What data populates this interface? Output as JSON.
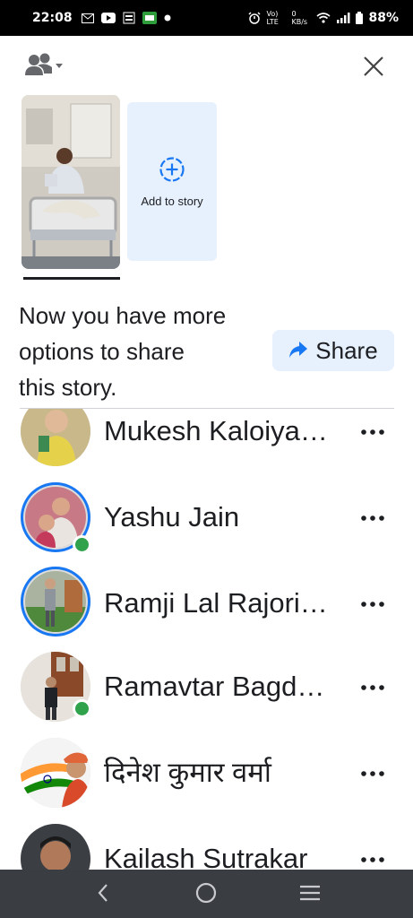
{
  "status_bar": {
    "time": "22:08",
    "battery": "88%",
    "network_label": "Vo) LTE",
    "data_rate": "0 KB/s"
  },
  "top_bar": {
    "audience_icon": "people-dropdown-icon",
    "close_icon": "close-icon"
  },
  "story": {
    "add_label": "Add to story",
    "add_icon": "plus-circle-icon"
  },
  "share": {
    "message_lines": [
      "Now you have more",
      "options to share",
      "this story."
    ],
    "button_label": "Share",
    "button_icon": "share-arrow-icon"
  },
  "friends": [
    {
      "name": "Mukesh Kaloiya…",
      "online": false,
      "story_ring": false
    },
    {
      "name": "Yashu Jain",
      "online": true,
      "story_ring": true
    },
    {
      "name": "Ramji Lal Rajori…",
      "online": false,
      "story_ring": true
    },
    {
      "name": "Ramavtar Bagd…",
      "online": true,
      "story_ring": false
    },
    {
      "name": "दिनेश कुमार वर्मा",
      "online": false,
      "story_ring": false
    },
    {
      "name": "Kailash Sutrakar",
      "online": false,
      "story_ring": false
    }
  ],
  "colors": {
    "accent": "#1877f2",
    "light_blue": "#e7f0fd",
    "online": "#31a24c",
    "text": "#1c1e21"
  }
}
